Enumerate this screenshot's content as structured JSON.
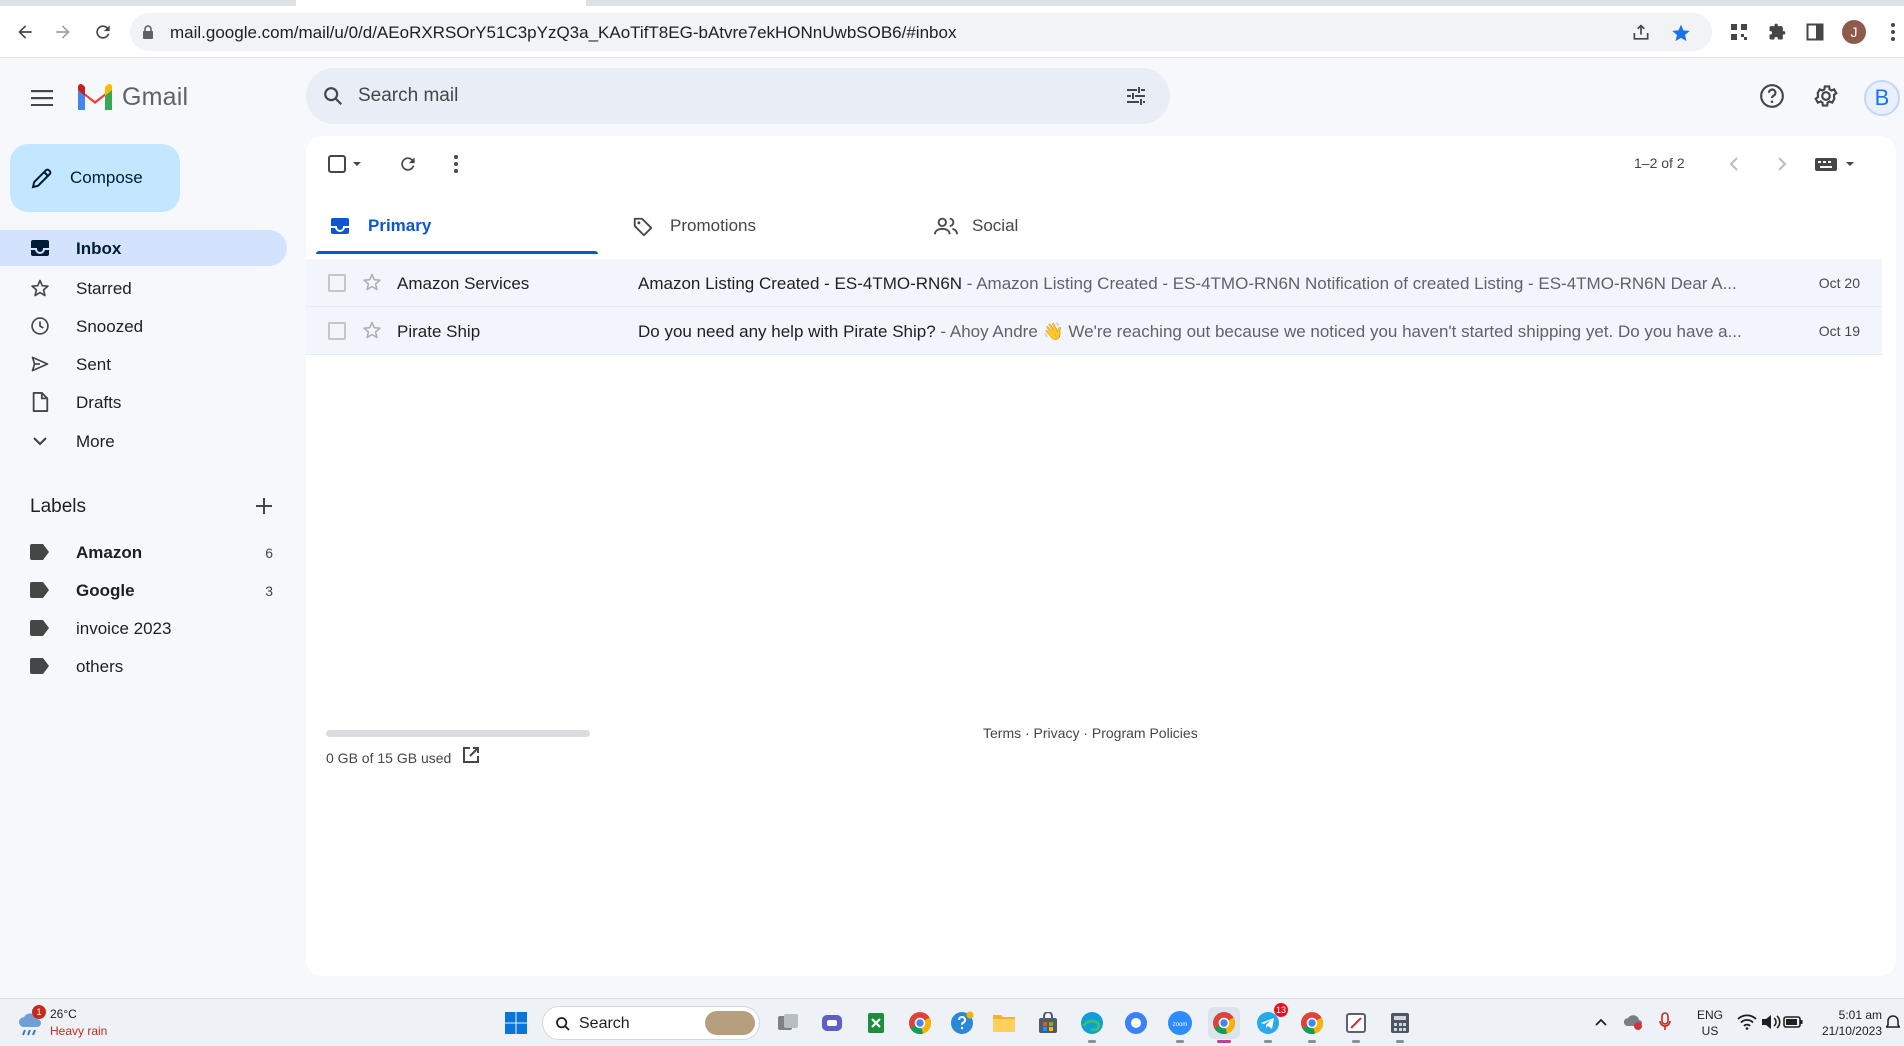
{
  "browser": {
    "url": "mail.google.com/mail/u/0/d/AEoRXRSOrY51C3pYzQ3a_KAoTifT8EG-bAtvre7ekHONnUwbSOB6/#inbox",
    "profile_initial": "J"
  },
  "header": {
    "app_name": "Gmail",
    "search_placeholder": "Search mail",
    "avatar_initial": "B"
  },
  "sidebar": {
    "compose_label": "Compose",
    "items": [
      {
        "label": "Inbox",
        "icon": "inbox-icon",
        "active": true
      },
      {
        "label": "Starred",
        "icon": "star-icon"
      },
      {
        "label": "Snoozed",
        "icon": "clock-icon"
      },
      {
        "label": "Sent",
        "icon": "send-icon"
      },
      {
        "label": "Drafts",
        "icon": "draft-icon"
      },
      {
        "label": "More",
        "icon": "chevron-down-icon"
      }
    ],
    "labels_title": "Labels",
    "labels": [
      {
        "name": "Amazon",
        "count": "6",
        "bold": true
      },
      {
        "name": "Google",
        "count": "3",
        "bold": true
      },
      {
        "name": "invoice 2023",
        "count": ""
      },
      {
        "name": "others",
        "count": ""
      }
    ]
  },
  "toolbar": {
    "pagination": "1–2 of 2"
  },
  "tabs": [
    {
      "label": "Primary",
      "icon": "inbox-icon",
      "active": true
    },
    {
      "label": "Promotions",
      "icon": "tag-icon"
    },
    {
      "label": "Social",
      "icon": "people-icon"
    }
  ],
  "emails": [
    {
      "sender": "Amazon Services",
      "subject": "Amazon Listing Created - ES-4TMO-RN6N",
      "snippet": " - Amazon Listing Created - ES-4TMO-RN6N Notification of created Listing - ES-4TMO-RN6N Dear A...",
      "date": "Oct 20"
    },
    {
      "sender": "Pirate Ship",
      "subject": "Do you need any help with Pirate Ship?",
      "snippet": " - Ahoy Andre 👋 We're reaching out because we noticed you haven't started shipping yet. Do you have a...",
      "date": "Oct 19"
    }
  ],
  "footer": {
    "storage_text": "0 GB of 15 GB used",
    "storage_used_fraction": 0,
    "links": "Terms · Privacy · Program Policies"
  },
  "taskbar": {
    "weather_temp": "26°C",
    "weather_condition": "Heavy rain",
    "weather_badge": "1",
    "search_label": "Search",
    "telegram_badge": "13",
    "lang_line1": "ENG",
    "lang_line2": "US",
    "time": "5:01 am",
    "date": "21/10/2023"
  },
  "colors": {
    "accent": "#0b57d0",
    "compose_bg": "#c2e7ff",
    "active_nav_bg": "#d3e3fd",
    "page_bg": "#f6f8fc"
  }
}
